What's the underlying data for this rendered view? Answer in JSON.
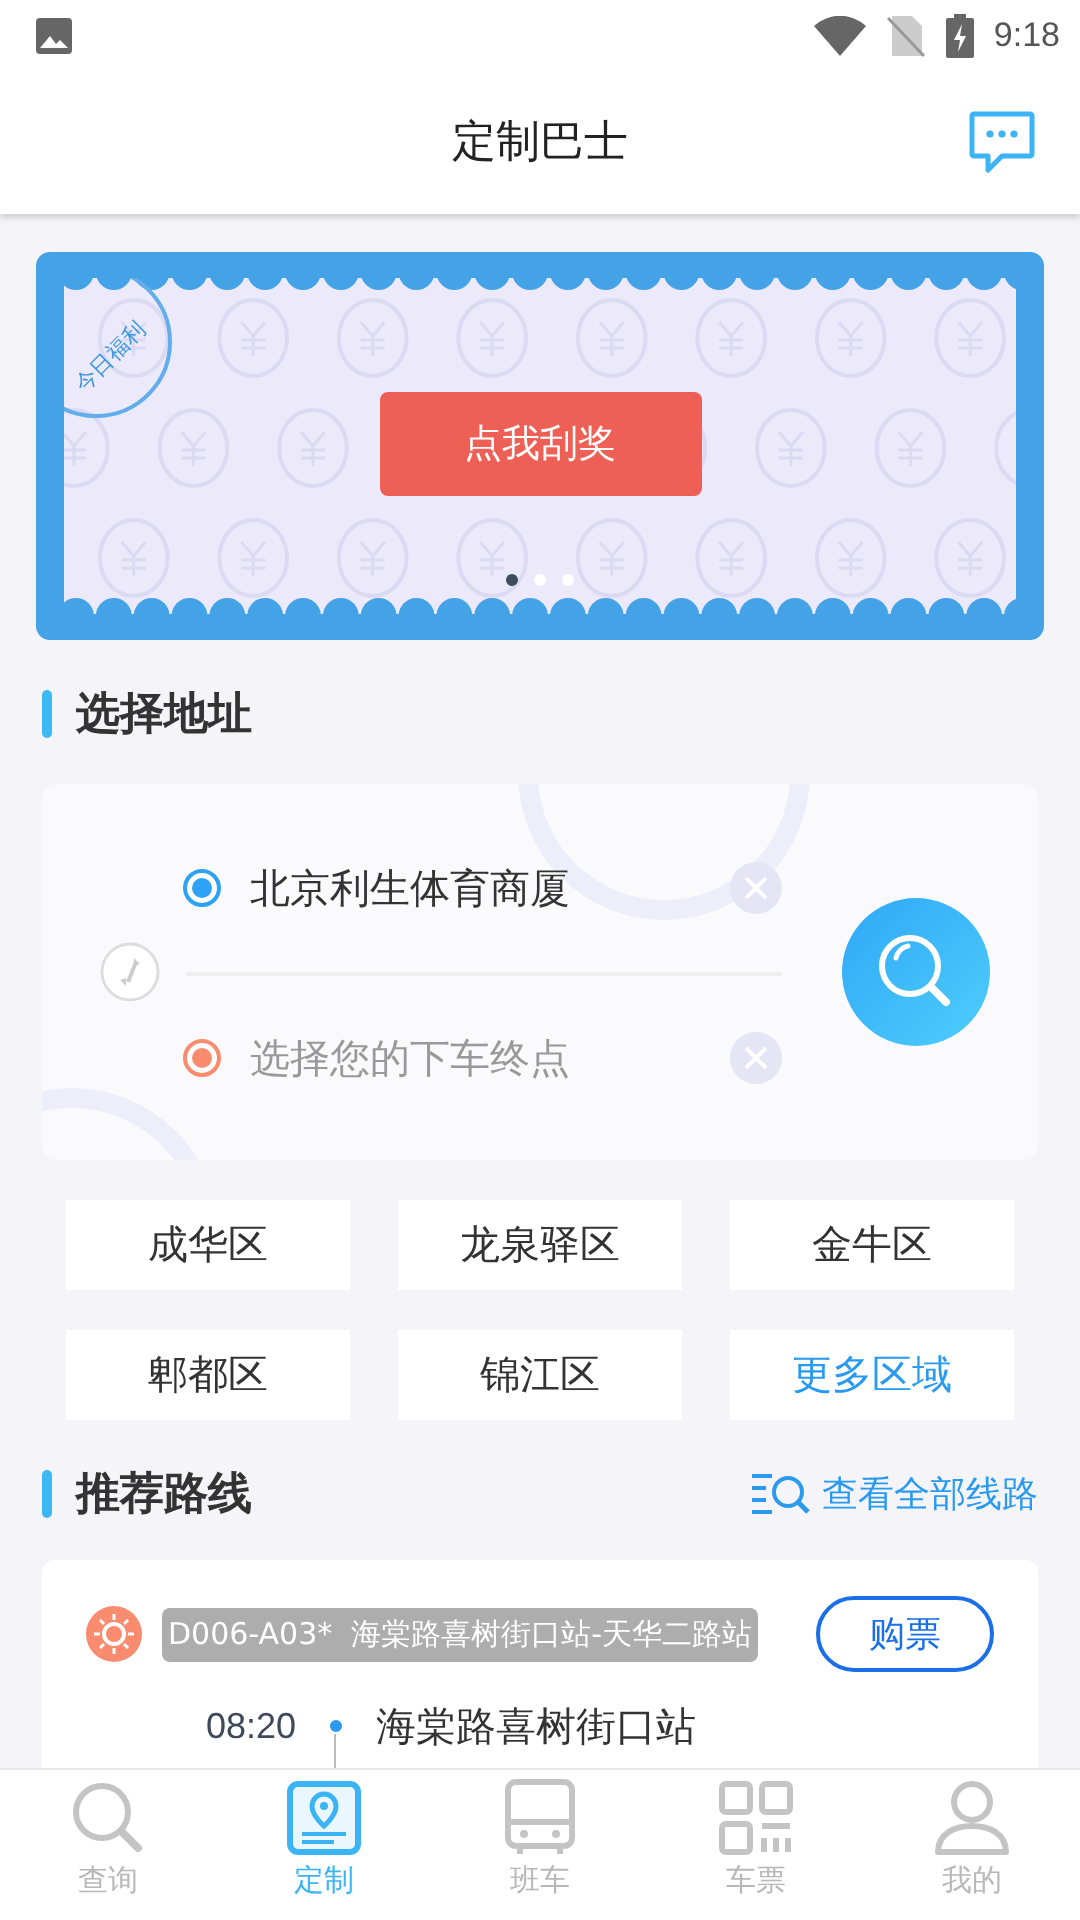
{
  "status_bar": {
    "time": "9:18"
  },
  "header": {
    "title": "定制巴士"
  },
  "banner": {
    "stamp": "今日福利",
    "button": "点我刮奖",
    "dots": [
      {
        "selected": true
      },
      {
        "selected": false
      },
      {
        "selected": false
      }
    ]
  },
  "address": {
    "title": "选择地址",
    "from": {
      "value": "北京利生体育商厦"
    },
    "to": {
      "placeholder": "选择您的下车终点"
    }
  },
  "districts": [
    {
      "label": "成华区",
      "kind": "district"
    },
    {
      "label": "龙泉驿区",
      "kind": "district"
    },
    {
      "label": "金牛区",
      "kind": "district"
    },
    {
      "label": "郫都区",
      "kind": "district"
    },
    {
      "label": "锦江区",
      "kind": "district"
    },
    {
      "label": "更多区域",
      "kind": "more"
    }
  ],
  "routes": {
    "title": "推荐路线",
    "link": "查看全部线路",
    "items": [
      {
        "tag": "D006-A03*  海棠路喜树街口站-天华二路站",
        "button": "购票",
        "stops": [
          {
            "time": "08:20",
            "name": "海棠路喜树街口站"
          }
        ]
      }
    ]
  },
  "tabs": [
    {
      "label": "查询",
      "kind": "search",
      "selected": false
    },
    {
      "label": "定制",
      "kind": "custom",
      "selected": true
    },
    {
      "label": "班车",
      "kind": "bus",
      "selected": false
    },
    {
      "label": "车票",
      "kind": "ticket",
      "selected": false
    },
    {
      "label": "我的",
      "kind": "profile",
      "selected": false
    }
  ]
}
